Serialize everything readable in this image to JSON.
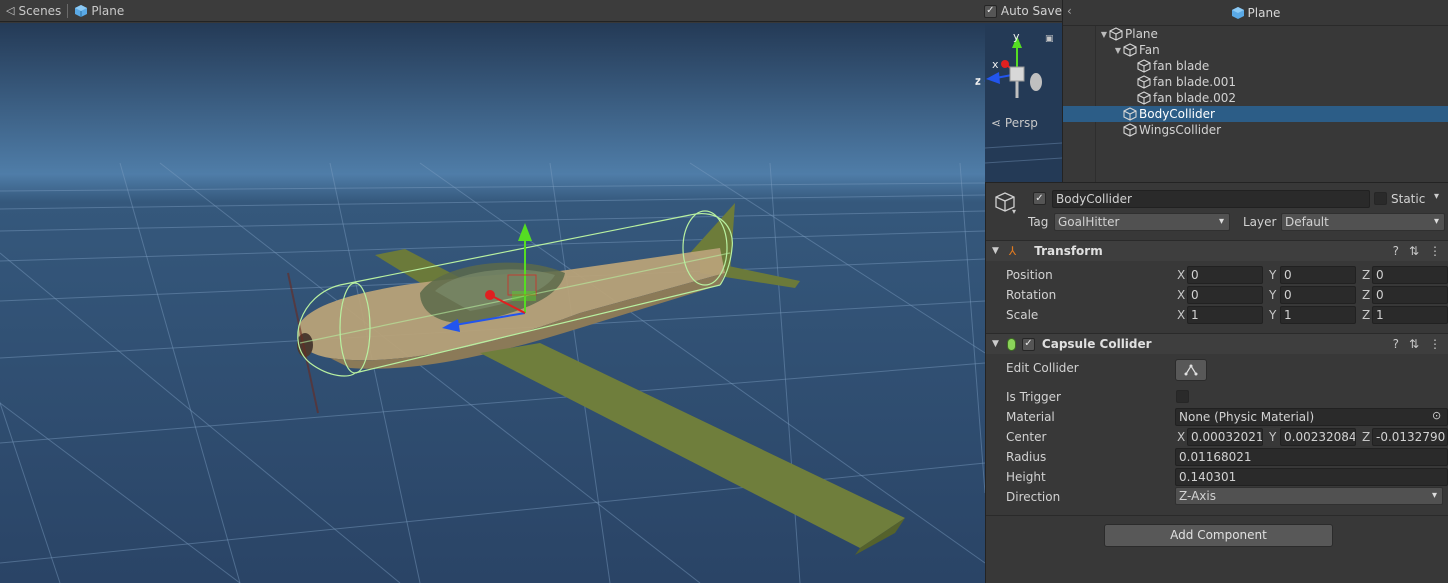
{
  "topbar": {
    "scenes_label": "Scenes",
    "prefab_label": "Plane",
    "autosave_label": "Auto Save",
    "autosave_checked": true
  },
  "scene_view": {
    "projection_label": "Persp",
    "gizmo_axes": {
      "x": "x",
      "y": "y",
      "z": "z"
    }
  },
  "hierarchy": {
    "title": "Plane",
    "items": [
      {
        "label": "Plane",
        "depth": 0,
        "expanded": true,
        "selected": false
      },
      {
        "label": "Fan",
        "depth": 1,
        "expanded": true,
        "selected": false
      },
      {
        "label": "fan blade",
        "depth": 2,
        "selected": false
      },
      {
        "label": "fan blade.001",
        "depth": 2,
        "selected": false
      },
      {
        "label": "fan blade.002",
        "depth": 2,
        "selected": false
      },
      {
        "label": "BodyCollider",
        "depth": 1,
        "selected": true
      },
      {
        "label": "WingsCollider",
        "depth": 1,
        "selected": false
      }
    ]
  },
  "inspector": {
    "object_name": "BodyCollider",
    "active": true,
    "static_label": "Static",
    "static_checked": false,
    "tag_label": "Tag",
    "tag_value": "GoalHitter",
    "layer_label": "Layer",
    "layer_value": "Default",
    "transform": {
      "title": "Transform",
      "position_label": "Position",
      "rotation_label": "Rotation",
      "scale_label": "Scale",
      "position": {
        "x": "0",
        "y": "0",
        "z": "0"
      },
      "rotation": {
        "x": "0",
        "y": "0",
        "z": "0"
      },
      "scale": {
        "x": "1",
        "y": "1",
        "z": "1"
      }
    },
    "capsule": {
      "title": "Capsule Collider",
      "enabled": true,
      "edit_collider_label": "Edit Collider",
      "is_trigger_label": "Is Trigger",
      "is_trigger": false,
      "material_label": "Material",
      "material_value": "None (Physic Material)",
      "center_label": "Center",
      "center": {
        "x": "0.00032021",
        "y": "0.00232084",
        "z": "-0.0132790!"
      },
      "radius_label": "Radius",
      "radius_value": "0.01168021",
      "height_label": "Height",
      "height_value": "0.140301",
      "direction_label": "Direction",
      "direction_value": "Z-Axis"
    },
    "add_component_label": "Add Component"
  },
  "colors": {
    "selection": "#2c5d87",
    "scene_bg": "#253d59",
    "axis_x": "#e02020",
    "axis_y": "#55dd22",
    "axis_z": "#2255ee"
  }
}
